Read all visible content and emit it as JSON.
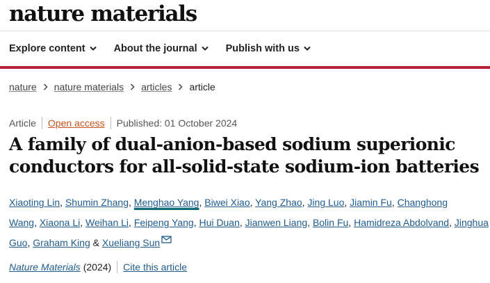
{
  "site": {
    "logo": "nature materials"
  },
  "nav": {
    "items": [
      {
        "label": "Explore content"
      },
      {
        "label": "About the journal"
      },
      {
        "label": "Publish with us"
      }
    ]
  },
  "breadcrumb": {
    "items": [
      {
        "label": "nature"
      },
      {
        "label": "nature materials"
      },
      {
        "label": "articles"
      }
    ],
    "current": "article"
  },
  "article": {
    "type": "Article",
    "access": "Open access",
    "published": "Published: 01 October 2024",
    "title": "A family of dual-anion-based sodium superionic conductors for all-solid-state sodium-ion batteries",
    "authors": [
      "Xiaoting Lin",
      "Shumin Zhang",
      "Menghao Yang",
      "Biwei Xiao",
      "Yang Zhao",
      "Jing Luo",
      "Jiamin Fu",
      "Changhong Wang",
      "Xiaona Li",
      "Weihan Li",
      "Feipeng Yang",
      "Hui Duan",
      "Jianwen Liang",
      "Bolin Fu",
      "Hamidreza Abdolvand",
      "Jinghua Guo",
      "Graham King",
      "Xueliang Sun"
    ],
    "author_sep": ", ",
    "author_last_sep": " & ",
    "journal": "Nature Materials",
    "year": "(2024)",
    "cite_label": "Cite this article"
  },
  "icons": {
    "nav_chevron": "chevron-down-icon",
    "crumb_separator": "chevron-right-icon",
    "corresponding": "envelope-icon"
  },
  "colors": {
    "brand_bar": "#b51f37",
    "link": "#1f5b8c",
    "open_access": "#c4531e",
    "highlight_underline": "#0f6b78"
  }
}
